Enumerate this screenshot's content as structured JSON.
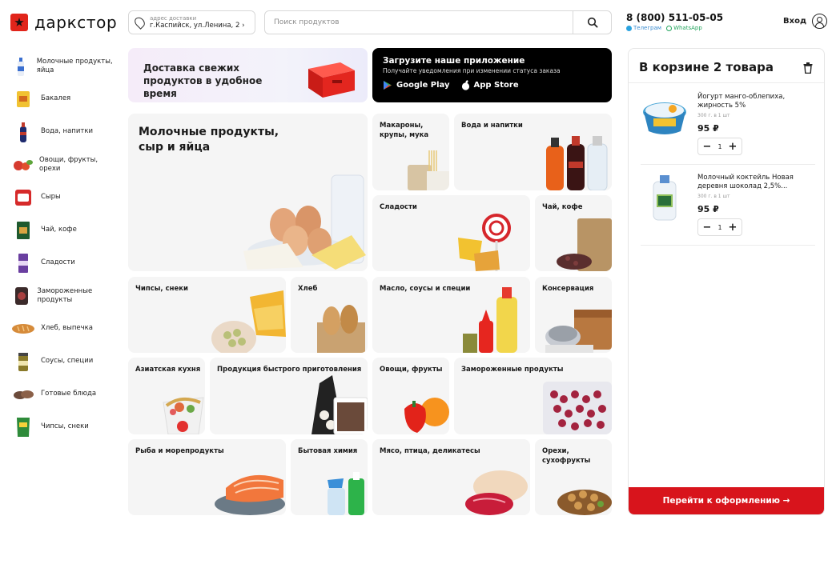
{
  "header": {
    "logo_text": "даркстор",
    "address_caption": "адрес доставки",
    "address_value": "г.Каспийск, ул.Ленина, 2",
    "address_chevron": "›",
    "search_placeholder": "Поиск продуктов",
    "phone": "8 (800) 511-05-05",
    "telegram": "Телеграм",
    "whatsapp": "WhatsApp",
    "login": "Вход"
  },
  "sidebar": [
    {
      "label": "Молочные продукты, яйца",
      "icon": "milk-bottle-icon"
    },
    {
      "label": "Бакалея",
      "icon": "grocery-pack-icon"
    },
    {
      "label": "Вода, напитки",
      "icon": "soda-bottle-icon"
    },
    {
      "label": "Овощи, фрукты, орехи",
      "icon": "vegetables-icon"
    },
    {
      "label": "Сыры",
      "icon": "cheese-icon"
    },
    {
      "label": "Чай, кофе",
      "icon": "tea-box-icon"
    },
    {
      "label": "Сладости",
      "icon": "candy-icon"
    },
    {
      "label": "Замороженные продукты",
      "icon": "frozen-pack-icon"
    },
    {
      "label": "Хлеб, выпечка",
      "icon": "bread-icon"
    },
    {
      "label": "Соусы, специи",
      "icon": "sauce-jar-icon"
    },
    {
      "label": "Готовые блюда",
      "icon": "ready-meal-icon"
    },
    {
      "label": "Чипсы, снеки",
      "icon": "chips-icon"
    }
  ],
  "banners": {
    "delivery": "Доставка свежих продуктов в удобное время",
    "app_title": "Загрузите наше приложение",
    "app_subtitle": "Получайте уведомления при изменении статуса заказа",
    "google_play": "Google Play",
    "app_store": "App Store"
  },
  "categories": {
    "dairy": "Молочные продукты, сыр и яйца",
    "pasta": "Макароны, крупы, мука",
    "water": "Вода и напитки",
    "sweets": "Сладости",
    "tea": "Чай, кофе",
    "chips": "Чипсы, снеки",
    "bread": "Хлеб",
    "oil": "Масло, соусы и специи",
    "canned": "Консервация",
    "asian": "Азиатская кухня",
    "fastfood": "Продукция быстрого приготовления",
    "veg": "Овощи, фрукты",
    "frozen": "Замороженные продукты",
    "fish": "Рыба и морепродукты",
    "household": "Бытовая химия",
    "meat": "Мясо, птица, деликатесы",
    "nuts": "Орехи, сухофрукты"
  },
  "cart": {
    "title": "В корзине 2 товара",
    "items": [
      {
        "name": "Йогурт манго-облепиха, жирность 5%",
        "note": "300 г. в 1 шт",
        "price": "95 ₽",
        "qty": "1"
      },
      {
        "name": "Молочный коктейль Новая деревня шоколад 2,5%...",
        "note": "300 г. в 1 шт",
        "price": "95 ₽",
        "qty": "1"
      }
    ],
    "checkout": "Перейти к оформлению →"
  },
  "colors": {
    "brand_red": "#e1251b",
    "checkout_red": "#d8141c",
    "tile_bg": "#f5f5f5"
  }
}
